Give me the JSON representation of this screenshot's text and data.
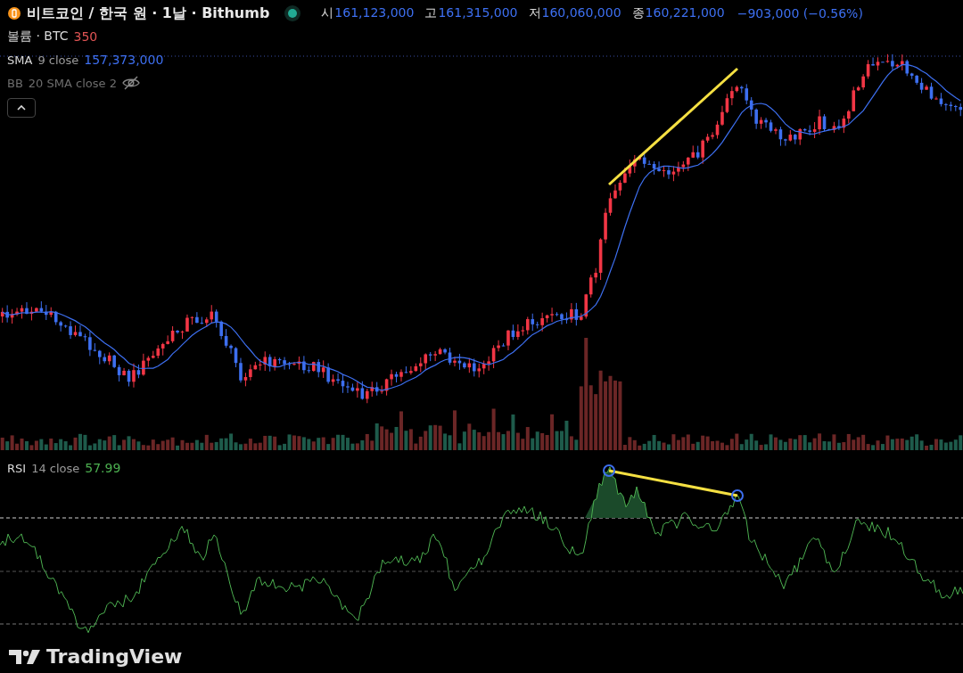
{
  "symbol": {
    "title": "비트코인 / 한국 원 · 1날 · Bithumb"
  },
  "ohlc": [
    {
      "label": "시",
      "value": "161,123,000"
    },
    {
      "label": "고",
      "value": "161,315,000"
    },
    {
      "label": "저",
      "value": "160,060,000"
    },
    {
      "label": "종",
      "value": "160,221,000"
    }
  ],
  "change": "−903,000 (−0.56%)",
  "indicators": [
    {
      "kind": "volume",
      "name": "볼륨 · BTC",
      "value": "350",
      "hidden": false
    },
    {
      "kind": "sma",
      "name": "SMA",
      "params": "9 close",
      "value": "157,373,000",
      "hidden": false
    },
    {
      "kind": "bb",
      "name": "BB",
      "params": "20 SMA close 2",
      "hidden": true
    }
  ],
  "rsi": {
    "name": "RSI",
    "params": "14 close",
    "value": "57.99"
  },
  "logo": "TradingView"
}
